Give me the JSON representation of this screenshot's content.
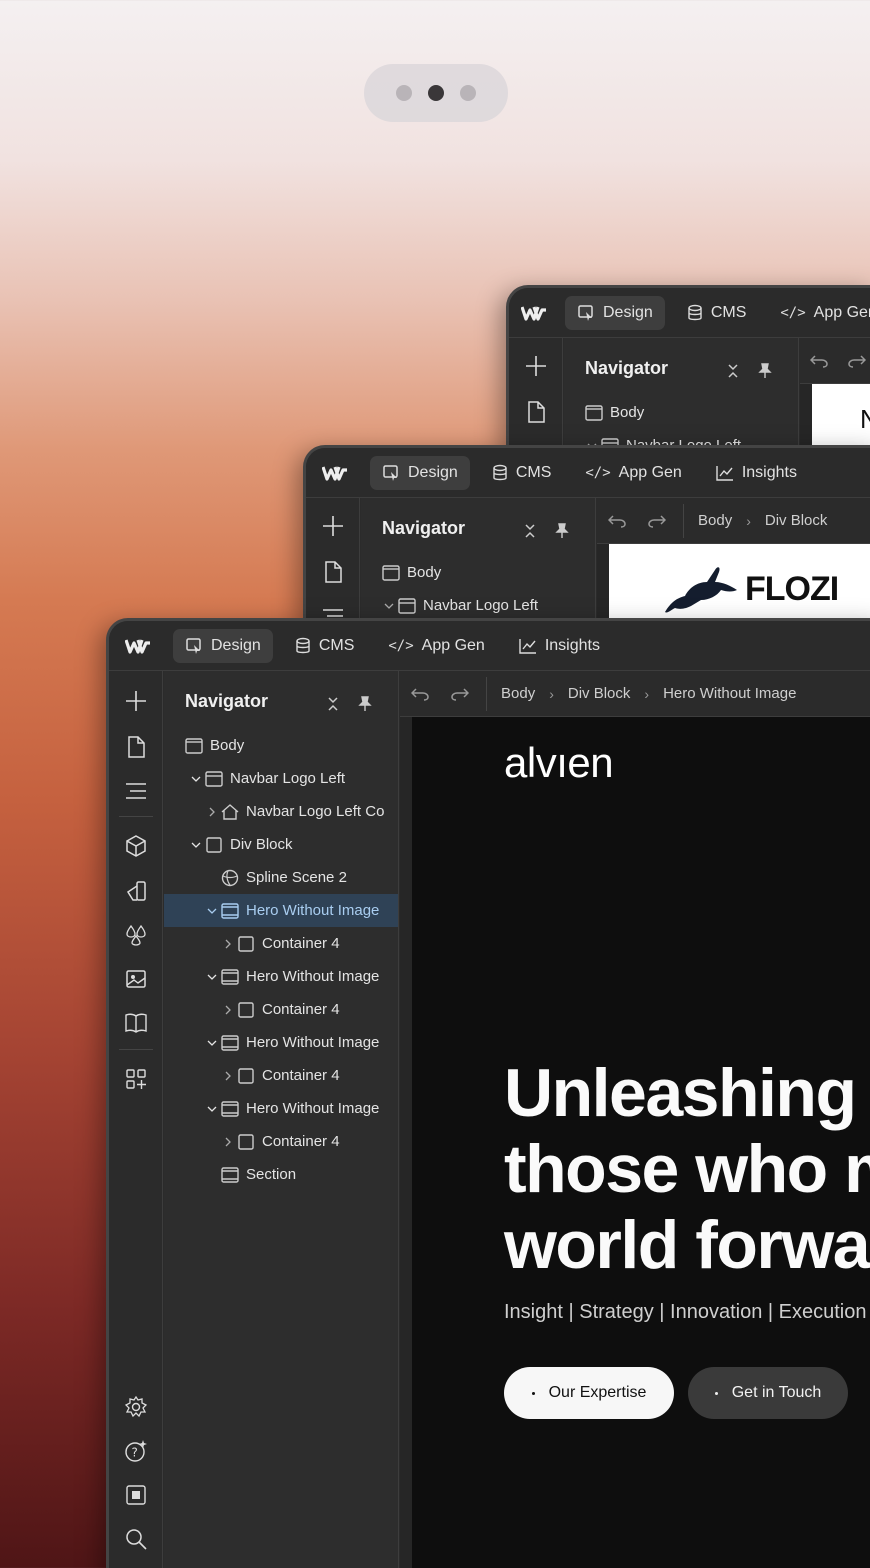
{
  "pager": {
    "dots": 3,
    "active_index": 1
  },
  "editor": {
    "tabs": [
      {
        "label": "Design"
      },
      {
        "label": "CMS"
      },
      {
        "label": "App Gen"
      },
      {
        "label": "Insights"
      }
    ],
    "navigator_title": "Navigator"
  },
  "window_back": {
    "tab_app_gen": "App Gen",
    "tree": [
      "Body",
      "Navbar Logo Left"
    ],
    "canvas_text": "N"
  },
  "window_middle": {
    "tree": [
      "Body",
      "Navbar Logo Left"
    ],
    "breadcrumb": [
      "Body",
      "Div Block"
    ],
    "logo_text": "FLOZI"
  },
  "window_front": {
    "breadcrumb": [
      "Body",
      "Div Block",
      "Hero Without Image"
    ],
    "tree": [
      {
        "label": "Body",
        "icon": "body-icon",
        "depth": 0,
        "chevron": "none"
      },
      {
        "label": "Navbar Logo Left",
        "icon": "navbar-icon",
        "depth": 1,
        "chevron": "down"
      },
      {
        "label": "Navbar Logo Left Co",
        "icon": "home-icon",
        "depth": 2,
        "chevron": "right"
      },
      {
        "label": "Div Block",
        "icon": "div-block-icon",
        "depth": 1,
        "chevron": "down"
      },
      {
        "label": "Spline Scene 2",
        "icon": "spline-icon",
        "depth": 2,
        "chevron": "none"
      },
      {
        "label": "Hero Without Image",
        "icon": "section-icon",
        "depth": 2,
        "chevron": "down",
        "selected": true
      },
      {
        "label": "Container 4",
        "icon": "container-icon",
        "depth": 3,
        "chevron": "right"
      },
      {
        "label": "Hero Without Image",
        "icon": "section-icon",
        "depth": 2,
        "chevron": "down"
      },
      {
        "label": "Container 4",
        "icon": "container-icon",
        "depth": 3,
        "chevron": "right"
      },
      {
        "label": "Hero Without Image",
        "icon": "section-icon",
        "depth": 2,
        "chevron": "down"
      },
      {
        "label": "Container 4",
        "icon": "container-icon",
        "depth": 3,
        "chevron": "right"
      },
      {
        "label": "Hero Without Image",
        "icon": "section-icon",
        "depth": 2,
        "chevron": "down"
      },
      {
        "label": "Container 4",
        "icon": "container-icon",
        "depth": 3,
        "chevron": "right"
      },
      {
        "label": "Section",
        "icon": "section-icon",
        "depth": 2,
        "chevron": "none"
      }
    ],
    "site": {
      "brand": "alvıen",
      "headline_lines": [
        "Unleashing p",
        "those who m",
        "world forwar"
      ],
      "tagline": "Insight | Strategy | Innovation | Execution",
      "primary_button": "Our Expertise",
      "secondary_button": "Get in Touch"
    }
  },
  "colors": {
    "selected_row_bg": "#2f4256",
    "selected_row_text": "#a9cdf0",
    "editor_bg": "#2b2b2b",
    "canvas_bg": "#0e0e0e"
  }
}
